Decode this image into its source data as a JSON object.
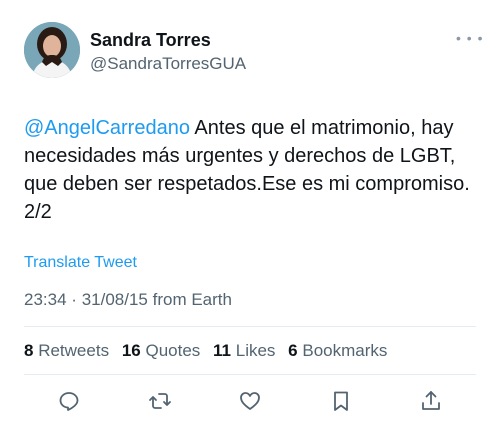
{
  "author": {
    "name": "Sandra Torres",
    "handle": "@SandraTorresGUA"
  },
  "tweet": {
    "mention": "@AngelCarredano",
    "text": " Antes que el matrimonio, hay necesidades más urgentes y derechos de LGBT, que deben ser respetados.Ese es mi compromiso. 2/2",
    "translate_label": "Translate Tweet",
    "time": "23:34",
    "separator": "·",
    "date": "31/08/15",
    "source": "from Earth"
  },
  "stats": {
    "retweets_count": "8",
    "retweets_label": "Retweets",
    "quotes_count": "16",
    "quotes_label": "Quotes",
    "likes_count": "11",
    "likes_label": "Likes",
    "bookmarks_count": "6",
    "bookmarks_label": "Bookmarks"
  },
  "icons": {
    "more": "more-horizontal-icon",
    "reply": "reply-icon",
    "retweet": "retweet-icon",
    "like": "heart-icon",
    "bookmark": "bookmark-icon",
    "share": "share-icon"
  },
  "colors": {
    "accent": "#1d9bf0",
    "text": "#0f1419",
    "secondary": "#536471"
  }
}
